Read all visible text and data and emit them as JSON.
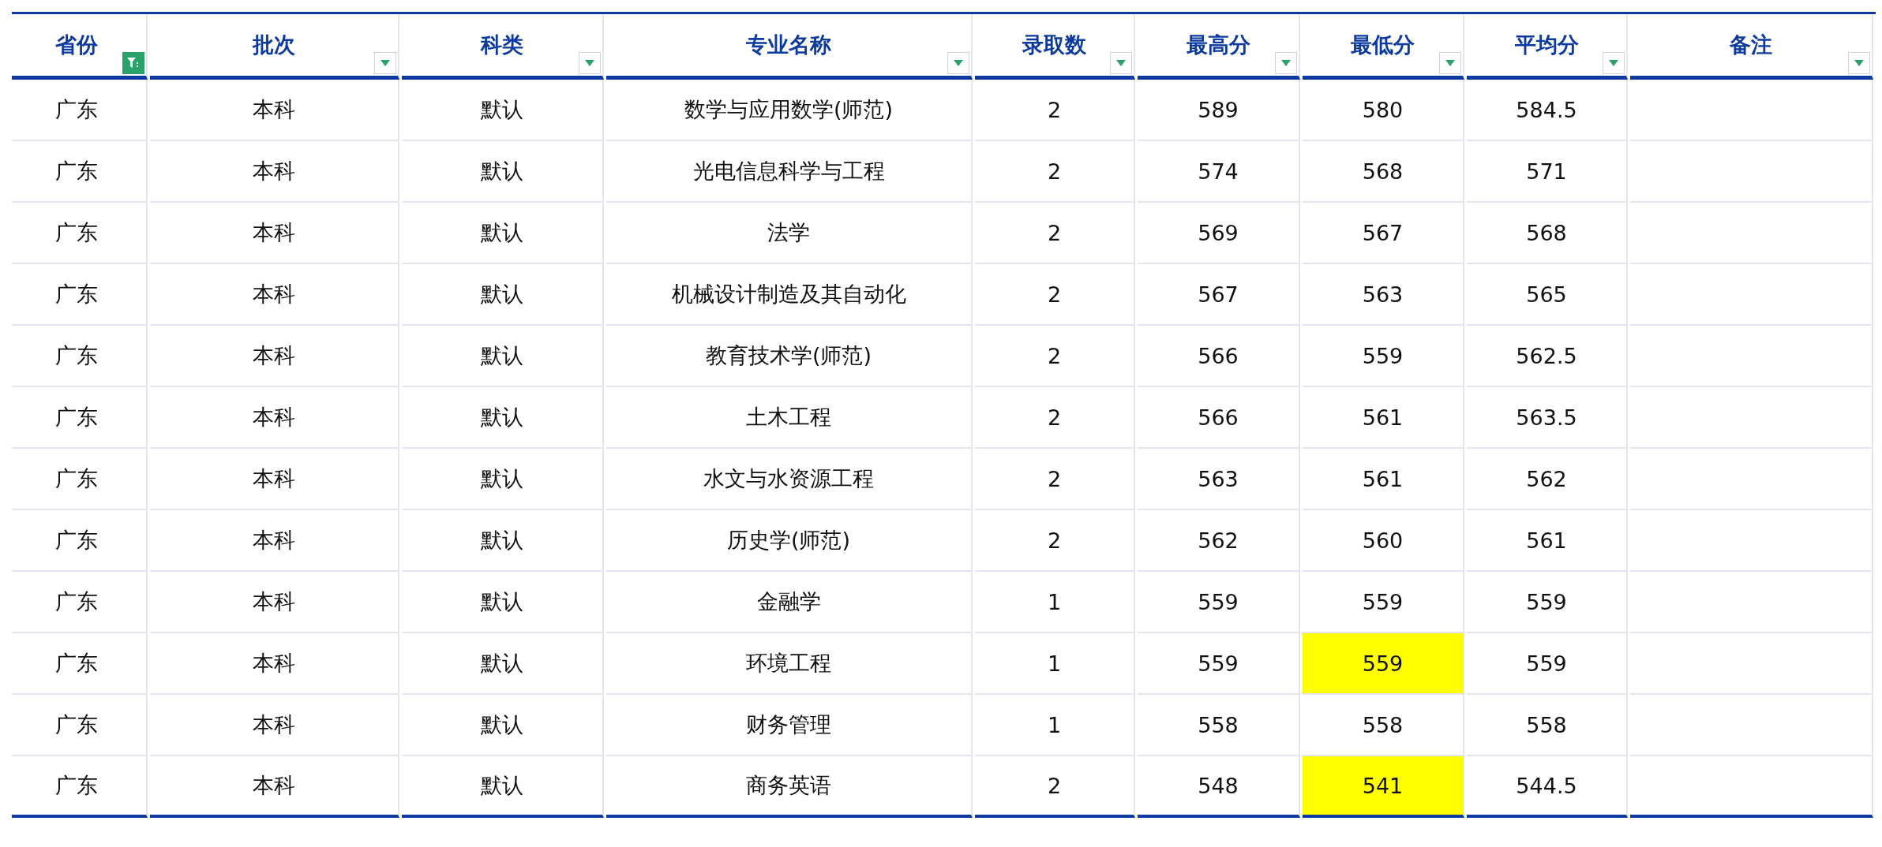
{
  "columns": [
    {
      "label": "省份",
      "filtered": true
    },
    {
      "label": "批次",
      "filtered": false
    },
    {
      "label": "科类",
      "filtered": false
    },
    {
      "label": "专业名称",
      "filtered": false
    },
    {
      "label": "录取数",
      "filtered": false
    },
    {
      "label": "最高分",
      "filtered": false
    },
    {
      "label": "最低分",
      "filtered": false
    },
    {
      "label": "平均分",
      "filtered": false
    },
    {
      "label": "备注",
      "filtered": false
    }
  ],
  "rows": [
    {
      "cells": [
        "广东",
        "本科",
        "默认",
        "数学与应用数学(师范)",
        "2",
        "589",
        "580",
        "584.5"
      ],
      "min_highlighted": false
    },
    {
      "cells": [
        "广东",
        "本科",
        "默认",
        "光电信息科学与工程",
        "2",
        "574",
        "568",
        "571"
      ],
      "min_highlighted": false
    },
    {
      "cells": [
        "广东",
        "本科",
        "默认",
        "法学",
        "2",
        "569",
        "567",
        "568"
      ],
      "min_highlighted": false
    },
    {
      "cells": [
        "广东",
        "本科",
        "默认",
        "机械设计制造及其自动化",
        "2",
        "567",
        "563",
        "565"
      ],
      "min_highlighted": false
    },
    {
      "cells": [
        "广东",
        "本科",
        "默认",
        "教育技术学(师范)",
        "2",
        "566",
        "559",
        "562.5"
      ],
      "min_highlighted": false
    },
    {
      "cells": [
        "广东",
        "本科",
        "默认",
        "土木工程",
        "2",
        "566",
        "561",
        "563.5"
      ],
      "min_highlighted": false
    },
    {
      "cells": [
        "广东",
        "本科",
        "默认",
        "水文与水资源工程",
        "2",
        "563",
        "561",
        "562"
      ],
      "min_highlighted": false
    },
    {
      "cells": [
        "广东",
        "本科",
        "默认",
        "历史学(师范)",
        "2",
        "562",
        "560",
        "561"
      ],
      "min_highlighted": false
    },
    {
      "cells": [
        "广东",
        "本科",
        "默认",
        "金融学",
        "1",
        "559",
        "559",
        "559"
      ],
      "min_highlighted": false
    },
    {
      "cells": [
        "广东",
        "本科",
        "默认",
        "环境工程",
        "1",
        "559",
        "559",
        "559"
      ],
      "min_highlighted": true
    },
    {
      "cells": [
        "广东",
        "本科",
        "默认",
        "财务管理",
        "1",
        "558",
        "558",
        "558"
      ],
      "min_highlighted": false
    },
    {
      "cells": [
        "广东",
        "本科",
        "默认",
        "商务英语",
        "2",
        "548",
        "541",
        "544.5"
      ],
      "min_highlighted": true
    }
  ]
}
